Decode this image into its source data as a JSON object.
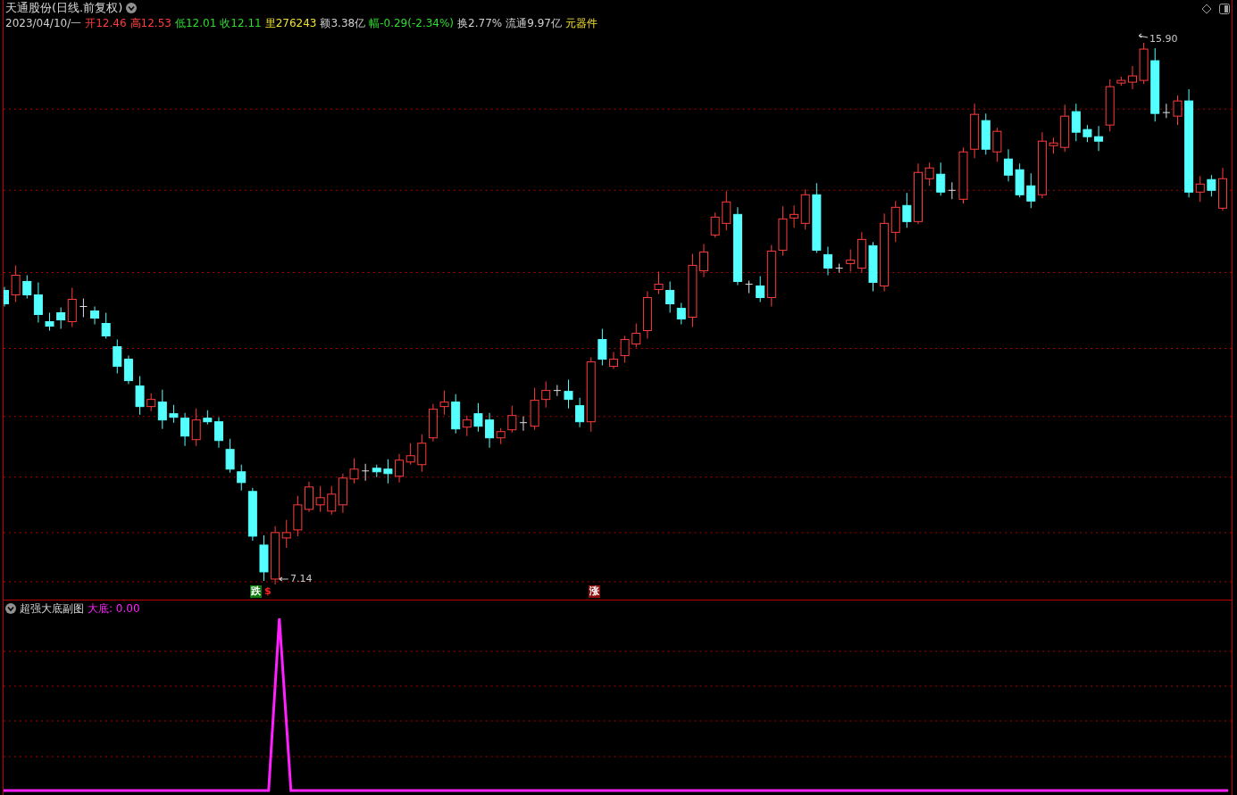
{
  "header": {
    "title": "天通股份(日线.前复权)",
    "quote": [
      {
        "text": "2023/04/10/一",
        "kind": "neutral"
      },
      {
        "text": "开12.46",
        "kind": "up"
      },
      {
        "text": "高12.53",
        "kind": "up"
      },
      {
        "text": "低12.01",
        "kind": "down"
      },
      {
        "text": "收12.11",
        "kind": "down"
      },
      {
        "text": "里276243",
        "kind": "highlight"
      },
      {
        "text": "额3.38亿",
        "kind": "neutral"
      },
      {
        "text": "幅-0.29(-2.34%)",
        "kind": "down"
      },
      {
        "text": "换2.77%",
        "kind": "neutral"
      },
      {
        "text": "流通9.97亿",
        "kind": "neutral"
      },
      {
        "text": "元器件",
        "kind": "highlight"
      }
    ]
  },
  "price_chart": {
    "high_label": "15.90",
    "low_label": "7.14",
    "signals": [
      {
        "text": "跌",
        "kind": "fall"
      },
      {
        "text": "$",
        "kind": "dollar"
      },
      {
        "text": "涨",
        "kind": "rise"
      }
    ]
  },
  "indicator": {
    "title": "超强大底副图",
    "reading": "大底: 0.00"
  }
}
